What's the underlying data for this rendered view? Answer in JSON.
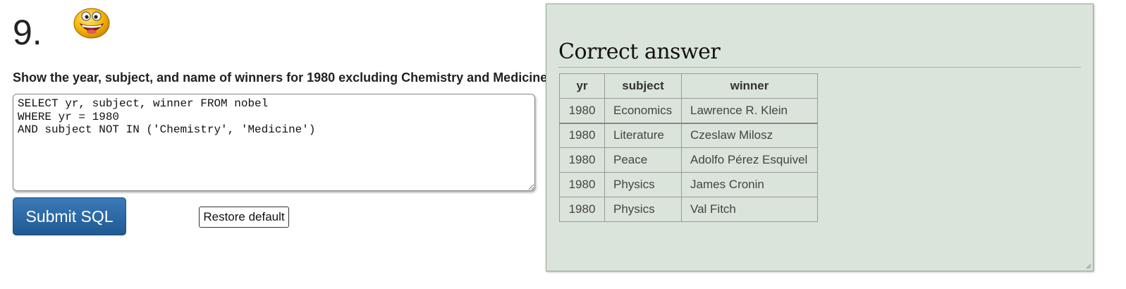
{
  "question": {
    "number": "9.",
    "text": "Show the year, subject, and name of winners for 1980 excluding Chemistry and Medicine",
    "status_icon": "smiley-face-icon"
  },
  "editor": {
    "sql": "SELECT yr, subject, winner FROM nobel\nWHERE yr = 1980\nAND subject NOT IN ('Chemistry', 'Medicine')"
  },
  "buttons": {
    "submit_label": "Submit SQL",
    "restore_label": "Restore default"
  },
  "answer": {
    "title": "Correct answer",
    "columns": [
      "yr",
      "subject",
      "winner"
    ],
    "rows": [
      [
        "1980",
        "Economics",
        "Lawrence R. Klein"
      ],
      [
        "1980",
        "Literature",
        "Czeslaw Milosz"
      ],
      [
        "1980",
        "Peace",
        "Adolfo Pérez Esquivel"
      ],
      [
        "1980",
        "Physics",
        "James Cronin"
      ],
      [
        "1980",
        "Physics",
        "Val Fitch"
      ]
    ]
  },
  "colors": {
    "submit_button": "#2a6aa6",
    "answer_panel_bg": "#dae4da"
  }
}
